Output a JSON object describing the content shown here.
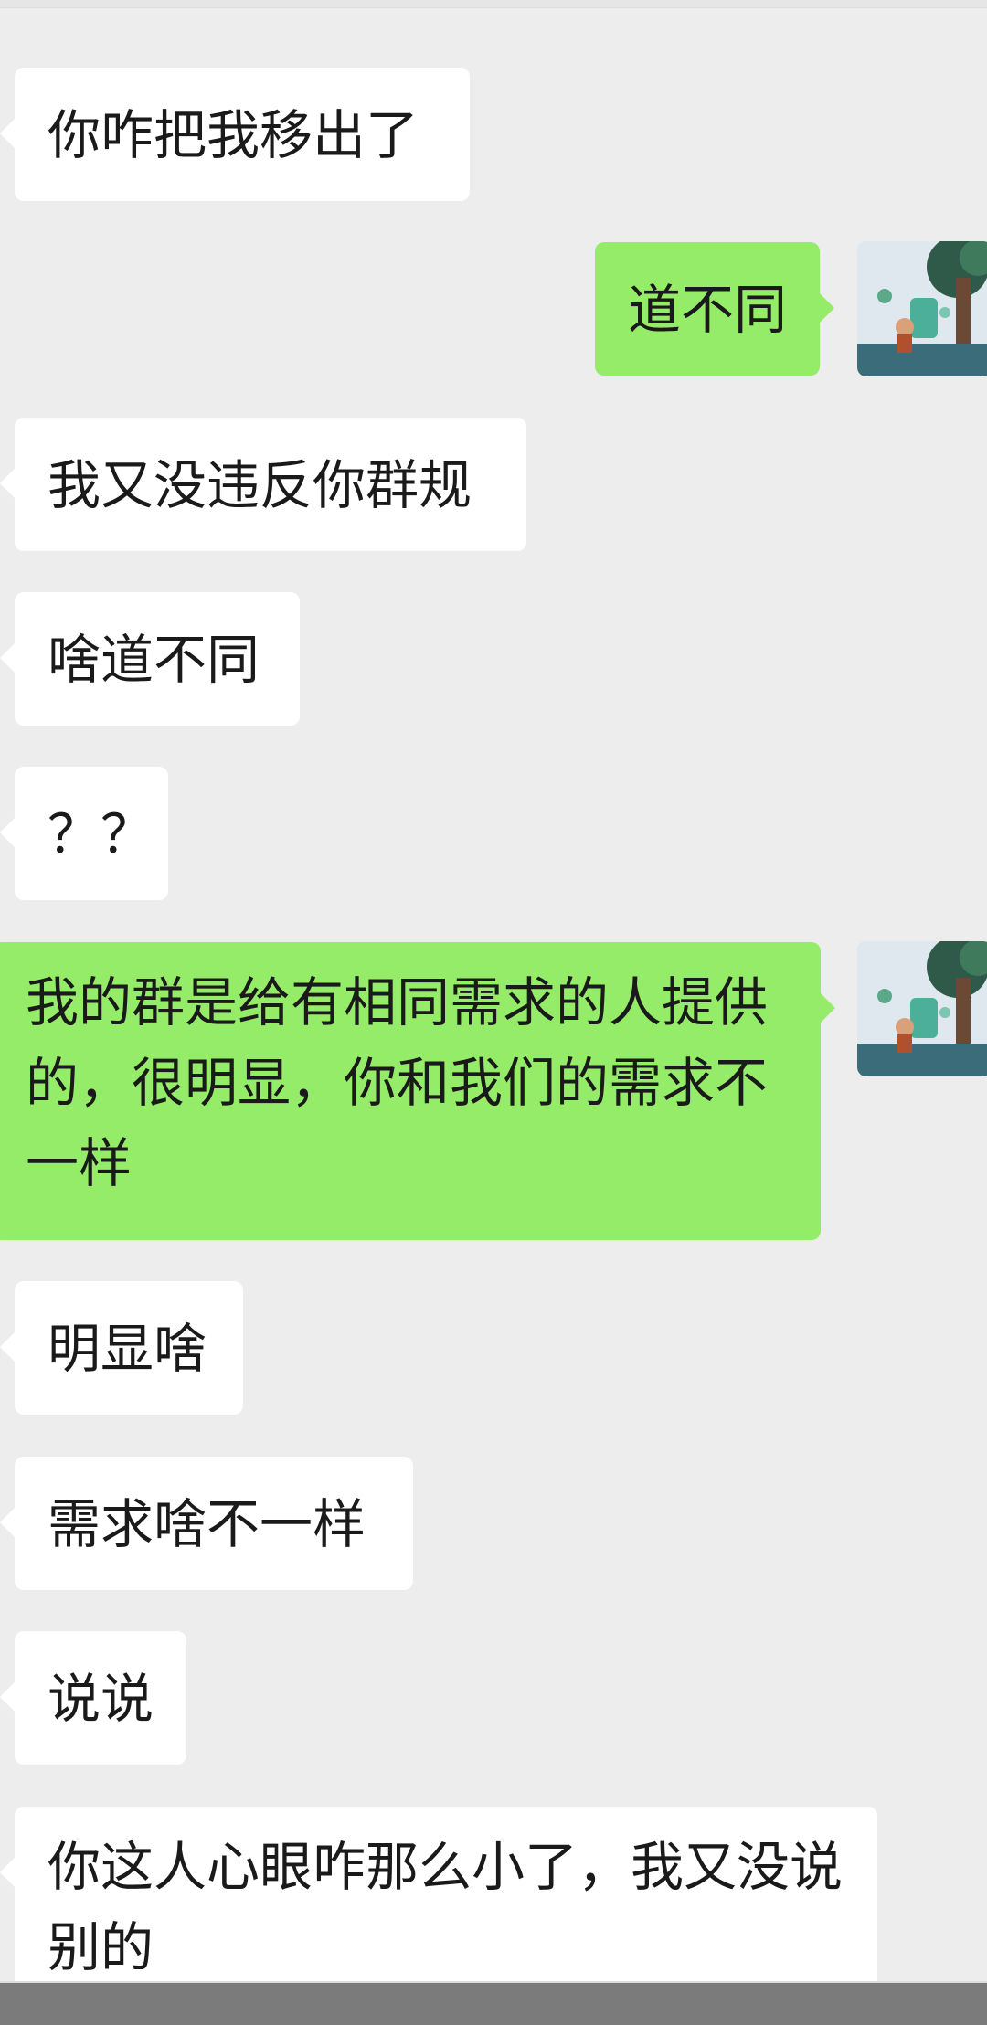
{
  "conversation": {
    "messages": [
      {
        "side": "in",
        "text": "你咋把我移出了"
      },
      {
        "side": "out",
        "text": "道不同"
      },
      {
        "side": "in",
        "text": "我又没违反你群规"
      },
      {
        "side": "in",
        "text": "啥道不同"
      },
      {
        "side": "in",
        "text": "？？"
      },
      {
        "side": "out",
        "text": "我的群是给有相同需求的人提供的，很明显，你和我们的需求不一样"
      },
      {
        "side": "in",
        "text": "明显啥"
      },
      {
        "side": "in",
        "text": "需求啥不一样"
      },
      {
        "side": "in",
        "text": "说说"
      },
      {
        "side": "in",
        "text": "你这人心眼咋那么小了，我又没说别的"
      }
    ]
  },
  "colors": {
    "background": "#ededed",
    "incoming_bubble": "#ffffff",
    "outgoing_bubble": "#95ec69",
    "text": "#1a1a1a"
  },
  "icons": {
    "self_avatar": "avatar-illustration-tree-child-icon"
  }
}
